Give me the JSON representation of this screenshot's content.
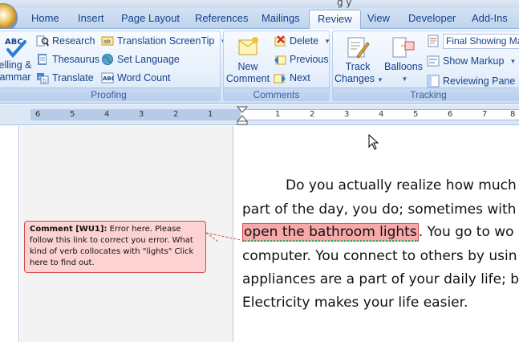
{
  "window": {
    "title_fragment": "g y"
  },
  "tabs": [
    {
      "label": "Home",
      "active": false
    },
    {
      "label": "Insert",
      "active": false
    },
    {
      "label": "Page Layout",
      "active": false
    },
    {
      "label": "References",
      "active": false
    },
    {
      "label": "Mailings",
      "active": false
    },
    {
      "label": "Review",
      "active": true
    },
    {
      "label": "View",
      "active": false
    },
    {
      "label": "Developer",
      "active": false
    },
    {
      "label": "Add-Ins",
      "active": false
    }
  ],
  "ribbon": {
    "proofing": {
      "label": "Proofing",
      "spelling_line1": "elling &",
      "spelling_line2": "ammar",
      "research": "Research",
      "thesaurus": "Thesaurus",
      "translate": "Translate",
      "translation_screentip": "Translation ScreenTip",
      "set_language": "Set Language",
      "word_count": "Word Count"
    },
    "comments": {
      "label": "Comments",
      "new_comment_line1": "New",
      "new_comment_line2": "Comment",
      "delete": "Delete",
      "previous": "Previous",
      "next": "Next"
    },
    "tracking": {
      "label": "Tracking",
      "track_changes_line1": "Track",
      "track_changes_line2": "Changes",
      "balloons": "Balloons",
      "display_for_review": "Final Showing Ma",
      "show_markup": "Show Markup",
      "reviewing_pane": "Reviewing Pane"
    }
  },
  "ruler": {
    "left_numbers": [
      "6",
      "5",
      "4",
      "3",
      "2",
      "1"
    ],
    "right_numbers": [
      "1",
      "2",
      "3",
      "4",
      "5",
      "6",
      "7",
      "8"
    ]
  },
  "document": {
    "line1": "Do you actually realize how much",
    "line2": "part of the day, you do; sometimes with",
    "line3_highlight": "open the bathroom lights",
    "line3_rest": ". You go to wo",
    "line4": "computer. You connect to others by usin",
    "line5": "appliances are a part of your daily life; b",
    "line6": "Electricity makes your life easier."
  },
  "comment": {
    "label": "Comment [WU1]:",
    "text": "Error here. Please follow this link to correct you error. What kind of verb collocates with \"lights\" Click here to find out."
  }
}
